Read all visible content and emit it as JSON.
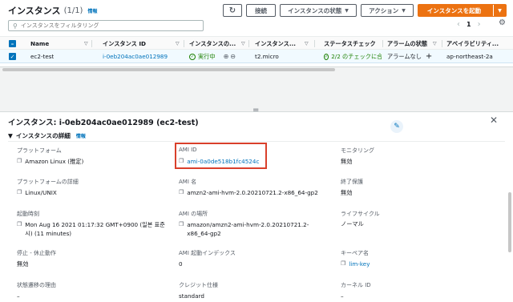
{
  "header": {
    "title": "インスタンス",
    "count": "(1/1)",
    "info": "情報",
    "refresh_icon": "↻",
    "connect": "接続",
    "state": "インスタンスの状態",
    "actions": "アクション",
    "launch": "インスタンスを起動"
  },
  "search": {
    "placeholder": "インスタンスをフィルタリング"
  },
  "pager": {
    "prev": "‹",
    "page": "1",
    "next": "›"
  },
  "table": {
    "columns": [
      "Name",
      "インスタンス ID",
      "インスタンスの...",
      "インスタンス...",
      "ステータスチェック",
      "アラームの状態",
      "アベイラビリティ..."
    ],
    "row": {
      "name": "ec2-test",
      "instance_id": "i-0eb204ac0ae012989",
      "state": "実行中",
      "type": "t2.micro",
      "status_check": "2/2 のチェックに合",
      "alarm": "アラームなし",
      "az": "ap-northeast-2a"
    }
  },
  "detail": {
    "title": "インスタンス: i-0eb204ac0ae012989 (ec2-test)",
    "section": "インスタンスの詳細",
    "section_info": "情報",
    "col1": [
      {
        "label": "プラットフォーム",
        "value": "Amazon Linux (推定)"
      },
      {
        "label": "プラットフォームの詳細",
        "value": "Linux/UNIX"
      },
      {
        "label": "起動時刻",
        "value": "Mon Aug 16 2021 01:17:32 GMT+0900 (일본 표준시) (11 minutes)"
      },
      {
        "label": "停止 - 休止動作",
        "value": "無効"
      },
      {
        "label": "状態遷移の理由",
        "value": "–"
      }
    ],
    "col2": [
      {
        "label": "AMI ID",
        "value": "ami-0a0de518b1fc4524c"
      },
      {
        "label": "AMI 名",
        "value": "amzn2-ami-hvm-2.0.20210721.2-x86_64-gp2"
      },
      {
        "label": "AMI の場所",
        "value": "amazon/amzn2-ami-hvm-2.0.20210721.2-x86_64-gp2"
      },
      {
        "label": "AMI 起動インデックス",
        "value": "0"
      },
      {
        "label": "クレジット仕様",
        "value": "standard"
      }
    ],
    "col3": [
      {
        "label": "モニタリング",
        "value": "無効"
      },
      {
        "label": "終了保護",
        "value": "無効"
      },
      {
        "label": "ライフサイクル",
        "value": "ノーマル"
      },
      {
        "label": "キーペア名",
        "value": "lim-key"
      },
      {
        "label": "カーネル ID",
        "value": "–"
      }
    ]
  },
  "colors": {
    "accent": "#ec7211",
    "link": "#0073bb",
    "running": "#1d8102",
    "highlight": "#d9402b"
  }
}
